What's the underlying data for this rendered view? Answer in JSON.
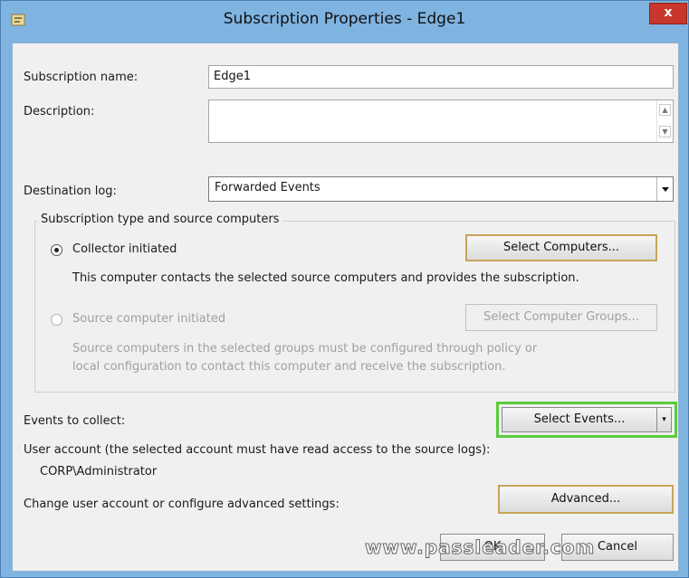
{
  "window": {
    "title": "Subscription Properties - Edge1",
    "close_glyph": "x"
  },
  "form": {
    "subscription_name_label": "Subscription name:",
    "subscription_name_value": "Edge1",
    "description_label": "Description:",
    "description_value": "",
    "destination_log_label": "Destination log:",
    "destination_log_value": "Forwarded Events"
  },
  "group": {
    "title": "Subscription type and source computers",
    "collector": {
      "label": "Collector initiated",
      "selected": true,
      "button": "Select Computers...",
      "description": "This computer contacts the selected source computers and provides the subscription."
    },
    "source": {
      "label": "Source computer initiated",
      "selected": false,
      "button": "Select Computer Groups...",
      "description_line1": "Source computers in the selected groups must be configured through policy or",
      "description_line2": "local configuration to contact this computer and receive the subscription."
    }
  },
  "events": {
    "label": "Events to collect:",
    "button": "Select Events..."
  },
  "account": {
    "label": "User account (the selected account must have read access to the source logs):",
    "value": "CORP\\Administrator",
    "advanced_label": "Change user account or configure advanced settings:",
    "advanced_button": "Advanced..."
  },
  "footer": {
    "ok": "OK",
    "cancel": "Cancel"
  },
  "watermark": "www.passleader.com",
  "colors": {
    "titlebar": "#7fb3e0",
    "close": "#c9372c",
    "highlight": "#5acb3b",
    "focus_border": "#c7a45a"
  },
  "icons": [
    "app-icon",
    "close-icon",
    "scroll-up-icon",
    "scroll-down-icon",
    "dropdown-arrow-icon",
    "split-arrow-icon"
  ]
}
